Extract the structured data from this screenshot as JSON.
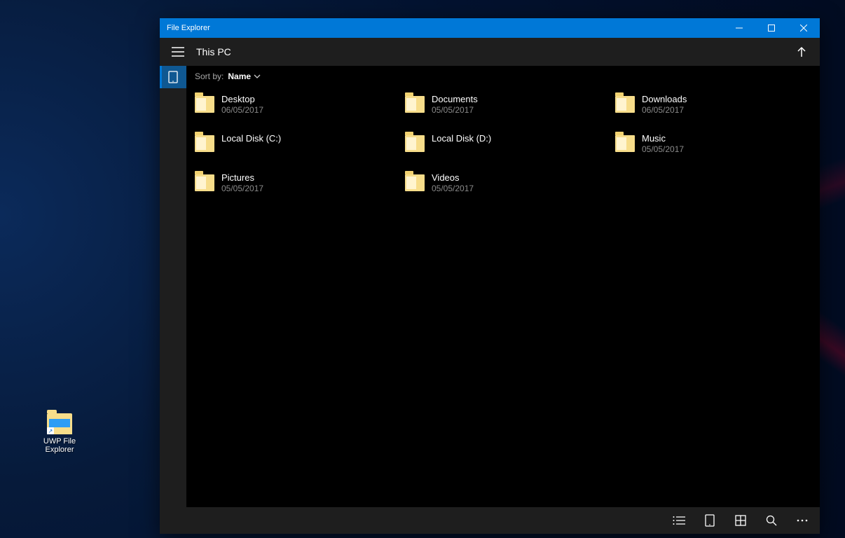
{
  "window": {
    "title": "File Explorer"
  },
  "commandbar": {
    "location": "This PC"
  },
  "sort": {
    "label": "Sort by:",
    "value": "Name"
  },
  "items": [
    {
      "name": "Desktop",
      "date": "06/05/2017"
    },
    {
      "name": "Documents",
      "date": "05/05/2017"
    },
    {
      "name": "Downloads",
      "date": "06/05/2017"
    },
    {
      "name": "Local Disk (C:)",
      "date": ""
    },
    {
      "name": "Local Disk (D:)",
      "date": ""
    },
    {
      "name": "Music",
      "date": "05/05/2017"
    },
    {
      "name": "Pictures",
      "date": "05/05/2017"
    },
    {
      "name": "Videos",
      "date": "05/05/2017"
    }
  ],
  "desktop_shortcut": {
    "label": "UWP File Explorer"
  }
}
